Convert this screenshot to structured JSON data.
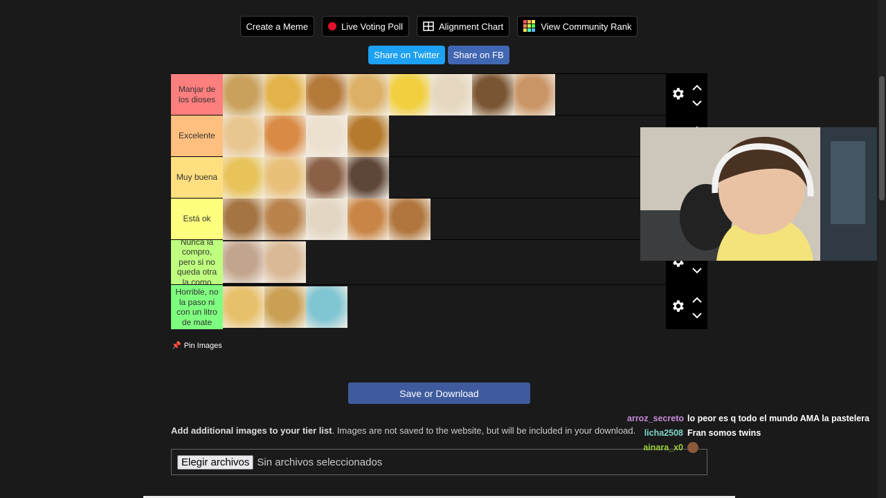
{
  "top_buttons": {
    "create_meme": "Create a Meme",
    "live_poll": "Live Voting Poll",
    "alignment": "Alignment Chart",
    "community_rank": "View Community Rank"
  },
  "share": {
    "twitter": "Share on Twitter",
    "fb": "Share on FB"
  },
  "tiers": [
    {
      "label": "Manjar de los dioses",
      "color": "#ff7f7f",
      "items": [
        "#c9a15c",
        "#e3b34a",
        "#b5793a",
        "#dcb066",
        "#f1cf3f",
        "#e6d8c0",
        "#7a5533",
        "#c99567"
      ]
    },
    {
      "label": "Excelente",
      "color": "#ffbf7f",
      "items": [
        "#e8c690",
        "#d98a44",
        "#ece0cf",
        "#b57a2e"
      ]
    },
    {
      "label": "Muy buena",
      "color": "#ffdf7f",
      "items": [
        "#e7c35a",
        "#e9c07a",
        "#8a6046",
        "#5e4638"
      ]
    },
    {
      "label": "Está ok",
      "color": "#ffff7f",
      "items": [
        "#a47443",
        "#b9834b",
        "#e3d7c4",
        "#c88545",
        "#b0763d"
      ]
    },
    {
      "label": "Nunca la compro, pero si no queda otra la como",
      "color": "#bfff7f",
      "items": [
        "#c2a58e",
        "#d9b996"
      ]
    },
    {
      "label": "Horrible, no la paso ni con un litro de mate",
      "color": "#7fff7f",
      "items": [
        "#e7c06b",
        "#caa054",
        "#80c5d2"
      ]
    }
  ],
  "pin_images": "Pin Images",
  "save_button": "Save or Download",
  "add_images": {
    "bold": "Add additional images to your tier list",
    "rest": ". Images are not saved to the website, but will be included in your download."
  },
  "file_input": {
    "button": "Elegir archivos",
    "status": "Sin archivos seleccionados"
  },
  "chat": [
    {
      "user": "arroz_secreto",
      "color": "#c78bd8",
      "text": "lo peor es q todo el mundo AMA la pastelera"
    },
    {
      "user": "licha2508",
      "color": "#7ed6c6",
      "text": "Fran somos twins"
    },
    {
      "user": "ainara_x0",
      "color": "#9acd32",
      "text": ""
    }
  ]
}
